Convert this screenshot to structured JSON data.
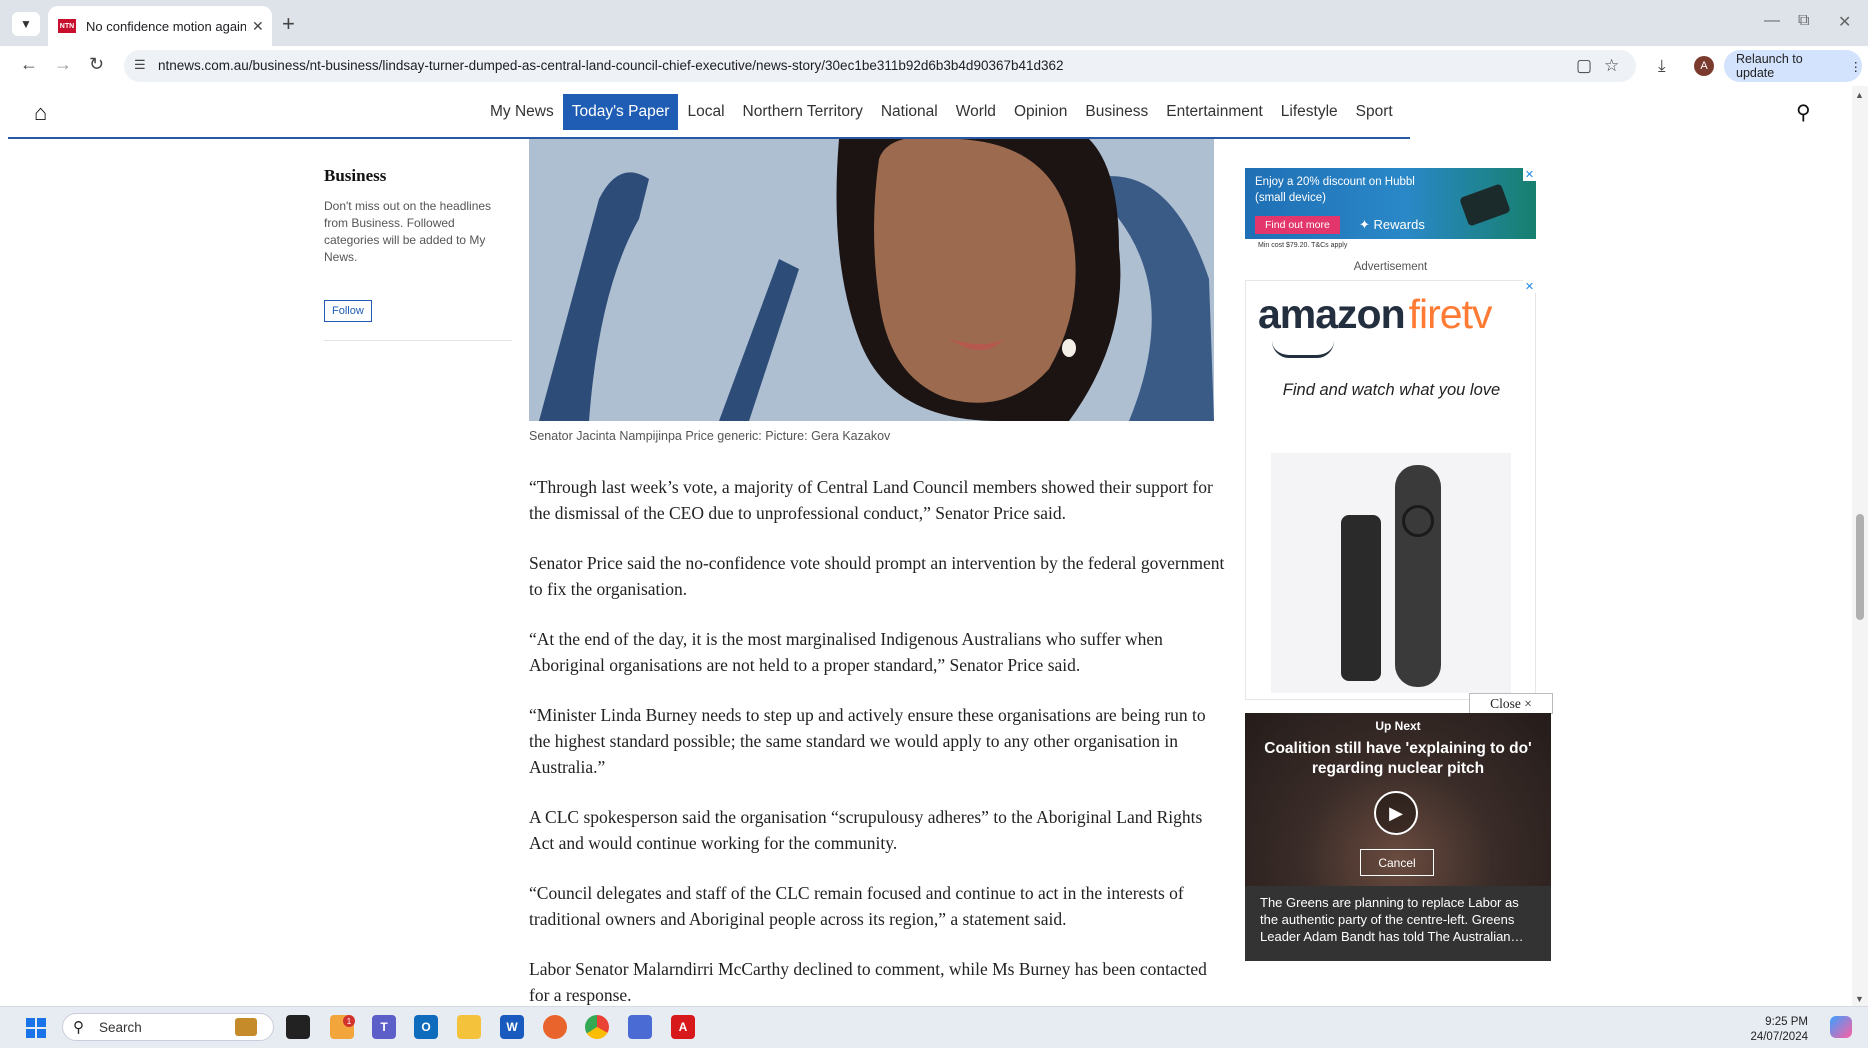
{
  "browser": {
    "tab_title": "No confidence motion against l",
    "url": "ntnews.com.au/business/nt-business/lindsay-turner-dumped-as-central-land-council-chief-executive/news-story/30ec1be311b92d6b3b4d90367b41d362",
    "relaunch_label": "Relaunch to update",
    "avatar_letter": "A",
    "favicon_text": "NTN"
  },
  "sitenav": {
    "items": [
      "My News",
      "Today's Paper",
      "Local",
      "Northern Territory",
      "National",
      "World",
      "Opinion",
      "Business",
      "Entertainment",
      "Lifestyle",
      "Sport"
    ],
    "active": "Today's Paper"
  },
  "sidebar": {
    "title": "Business",
    "text": "Don't miss out on the headlines from Business. Followed categories will be added to My News.",
    "follow_label": "Follow"
  },
  "hero": {
    "caption": "Senator Jacinta Nampijinpa Price generic: Picture: Gera Kazakov"
  },
  "article": {
    "paragraphs": [
      "“Through last week’s vote, a majority of Central Land Council members showed their support for the dismissal of the CEO due to unprofessional conduct,” Senator Price said.",
      "Senator Price said the no-confidence vote should prompt an intervention by the federal government to fix the organisation.",
      "“At the end of the day, it is the most marginalised Indigenous Australians who suffer when Aboriginal organisations are not held to a proper standard,” Senator Price said.",
      "“Minister Linda Burney needs to step up and actively ensure these organisations are being run to the highest standard possible; the same standard we would apply to any other organisation in Australia.”",
      "A CLC spokesperson said the organisation “scrupulousy adheres” to the Aboriginal Land Rights Act and would continue working for the community.",
      "“Council delegates and staff of the CLC remain focused and continue to act in the interests of traditional owners and Aboriginal people across its region,” a statement said.",
      "Labor Senator Malarndirri McCarthy declined to comment, while Ms Burney has been contacted for a response."
    ]
  },
  "ads": {
    "hubbl_text": "Enjoy a 20% discount on Hubbl (small device)",
    "hubbl_button": "Find out more",
    "hubbl_rewards": "Rewards",
    "hubbl_fine": "Min cost $79.20. T&Cs apply",
    "advertisement_label": "Advertisement",
    "amazon_logo_a": "amazon",
    "amazon_logo_b": "firetv",
    "amazon_tagline": "Find and watch what you love",
    "close_label": "Close ×"
  },
  "video": {
    "up_next": "Up Next",
    "title": "Coalition still have 'explaining to do' regarding nuclear pitch",
    "cancel_label": "Cancel",
    "description": "The Greens are planning to replace Labor as the authentic party of the centre-left. Greens Leader Adam Bandt has told The Australian…"
  },
  "taskbar": {
    "search_label": "Search",
    "time": "9:25 PM",
    "date": "24/07/2024",
    "notification_count": "1"
  },
  "colors": {
    "nav_active": "#1e5db3",
    "nav_rule": "#2857a4",
    "brand_red": "#c8102e"
  }
}
